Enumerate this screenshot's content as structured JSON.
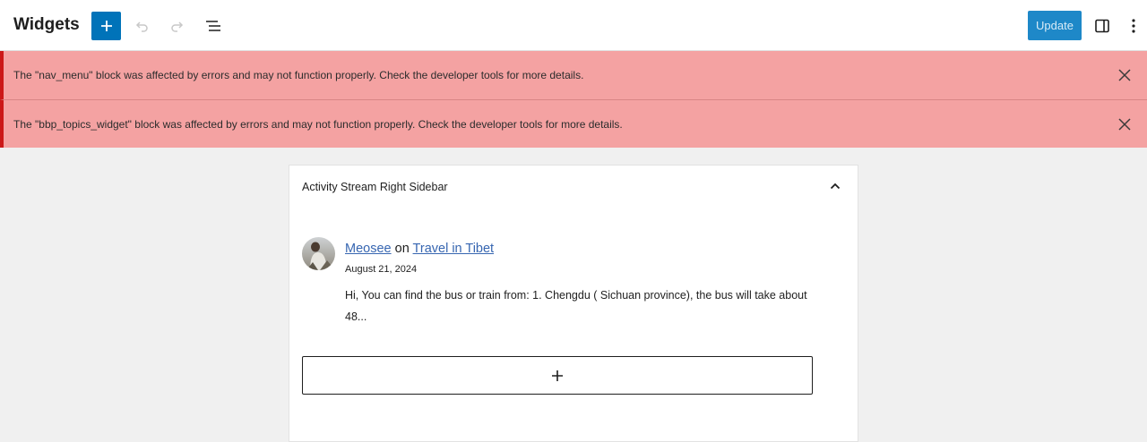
{
  "header": {
    "title": "Widgets",
    "update_label": "Update",
    "icons": {
      "add": "plus-icon",
      "undo": "undo-icon",
      "redo": "redo-icon",
      "list_view": "list-view-icon",
      "sidebar": "sidebar-toggle-icon",
      "more": "more-vertical-icon"
    }
  },
  "notices": [
    {
      "message": "The \"nav_menu\" block was affected by errors and may not function properly. Check the developer tools for more details."
    },
    {
      "message": "The \"bbp_topics_widget\" block was affected by errors and may not function properly. Check the developer tools for more details."
    }
  ],
  "widget_area": {
    "title": "Activity Stream Right Sidebar",
    "topic": {
      "author": "Meosee",
      "joiner": "on",
      "topic_title": "Travel in Tibet",
      "date": "August 21, 2024",
      "excerpt": "Hi, You can find the bus or train from: 1. Chengdu ( Sichuan province), the bus will take about 48..."
    },
    "appender_icon": "plus-icon"
  },
  "colors": {
    "accent": "#0073b9",
    "notice_bg": "#f4a2a2",
    "notice_border": "#cc1818",
    "link": "#3766b1"
  }
}
